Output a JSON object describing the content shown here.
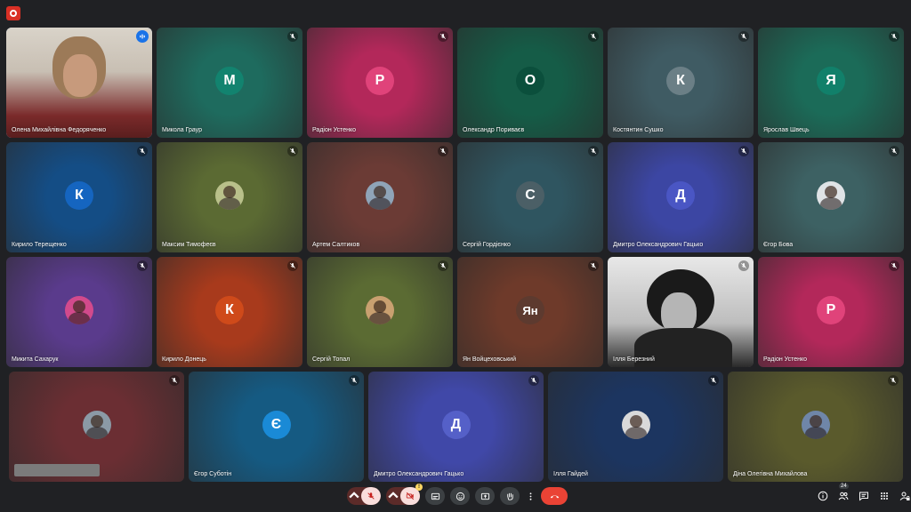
{
  "participants_row1": [
    {
      "name": "Олена Михайлівна Федоряченко",
      "initial": "",
      "bg": "#6b4a3e",
      "avatarBg": "",
      "type": "video",
      "speaking": true
    },
    {
      "name": "Микола Граур",
      "initial": "М",
      "bg": "#1e6b5e",
      "avatarBg": "#12836f",
      "type": "letter"
    },
    {
      "name": "Радіон Устенко",
      "initial": "Р",
      "bg": "#b3285a",
      "avatarBg": "#e0437a",
      "type": "letter"
    },
    {
      "name": "Олександр Пориваєв",
      "initial": "О",
      "bg": "#155c47",
      "avatarBg": "#0b4f3c",
      "type": "letter"
    },
    {
      "name": "Костянтин Сушко",
      "initial": "К",
      "bg": "#3f5b63",
      "avatarBg": "#6b7f86",
      "type": "letter"
    },
    {
      "name": "Ярослав Швець",
      "initial": "Я",
      "bg": "#1b6b58",
      "avatarBg": "#11806a",
      "type": "letter"
    }
  ],
  "participants_row2": [
    {
      "name": "Кирило Терещенко",
      "initial": "К",
      "bg": "#144d85",
      "avatarBg": "#1565c0",
      "type": "letter"
    },
    {
      "name": "Максим Тимофеєв",
      "initial": "",
      "bg": "#5b6a33",
      "avatarBg": "#b9c08a",
      "type": "photo"
    },
    {
      "name": "Артем Салтиков",
      "initial": "",
      "bg": "#6b3b35",
      "avatarBg": "#8fa4b8",
      "type": "photo"
    },
    {
      "name": "Сергій Гордієнко",
      "initial": "С",
      "bg": "#2f5560",
      "avatarBg": "#4b5f66",
      "type": "letter"
    },
    {
      "name": "Дмитро Олександрович Гацько",
      "initial": "Д",
      "bg": "#3c46a3",
      "avatarBg": "#4a56c4",
      "type": "letter"
    },
    {
      "name": "Єгор Бова",
      "initial": "",
      "bg": "#3d6163",
      "avatarBg": "#dfe3e6",
      "type": "photo"
    }
  ],
  "participants_row3": [
    {
      "name": "Микита Сахарук",
      "initial": "",
      "bg": "#5a3b8c",
      "avatarBg": "#d24a8c",
      "type": "photo"
    },
    {
      "name": "Кирило Донець",
      "initial": "К",
      "bg": "#a83a1c",
      "avatarBg": "#cf4a1a",
      "type": "letter"
    },
    {
      "name": "Сергій Топал",
      "initial": "",
      "bg": "#5b6b33",
      "avatarBg": "#c9a070",
      "type": "photo"
    },
    {
      "name": "Ян Войцеховський",
      "initial": "Ян",
      "bg": "#6e3a2a",
      "avatarBg": "#5d3a2f",
      "type": "letter"
    },
    {
      "name": "Ілля Березний",
      "initial": "",
      "bg": "#cfcfcf",
      "avatarBg": "",
      "type": "video"
    },
    {
      "name": "Радіон Устенко",
      "initial": "Р",
      "bg": "#b3285a",
      "avatarBg": "#e0437a",
      "type": "letter"
    }
  ],
  "participants_row4": [
    {
      "name": "",
      "initial": "",
      "bg": "#6b2e33",
      "avatarBg": "#8b9aa6",
      "type": "photo",
      "hiddenName": true
    },
    {
      "name": "Єгор Суботін",
      "initial": "Є",
      "bg": "#155a82",
      "avatarBg": "#1a8ad6",
      "type": "letter"
    },
    {
      "name": "Дмитро Олександрович Гацько",
      "initial": "Д",
      "bg": "#4048a8",
      "avatarBg": "#5560c8",
      "type": "letter"
    },
    {
      "name": "Ілля Гайдей",
      "initial": "",
      "bg": "#1c3560",
      "avatarBg": "#d9d9d9",
      "type": "photo"
    },
    {
      "name": "Діна Олегівна Михайлова",
      "initial": "",
      "bg": "#5a5a2c",
      "avatarBg": "#6f86a8",
      "type": "photo"
    }
  ],
  "controls": {
    "participants_count": "24"
  },
  "colors": {
    "background": "#202124",
    "end_call": "#ea4335",
    "muted_control": "#f9dedc",
    "speaking_outline": "#8ab4f8"
  }
}
